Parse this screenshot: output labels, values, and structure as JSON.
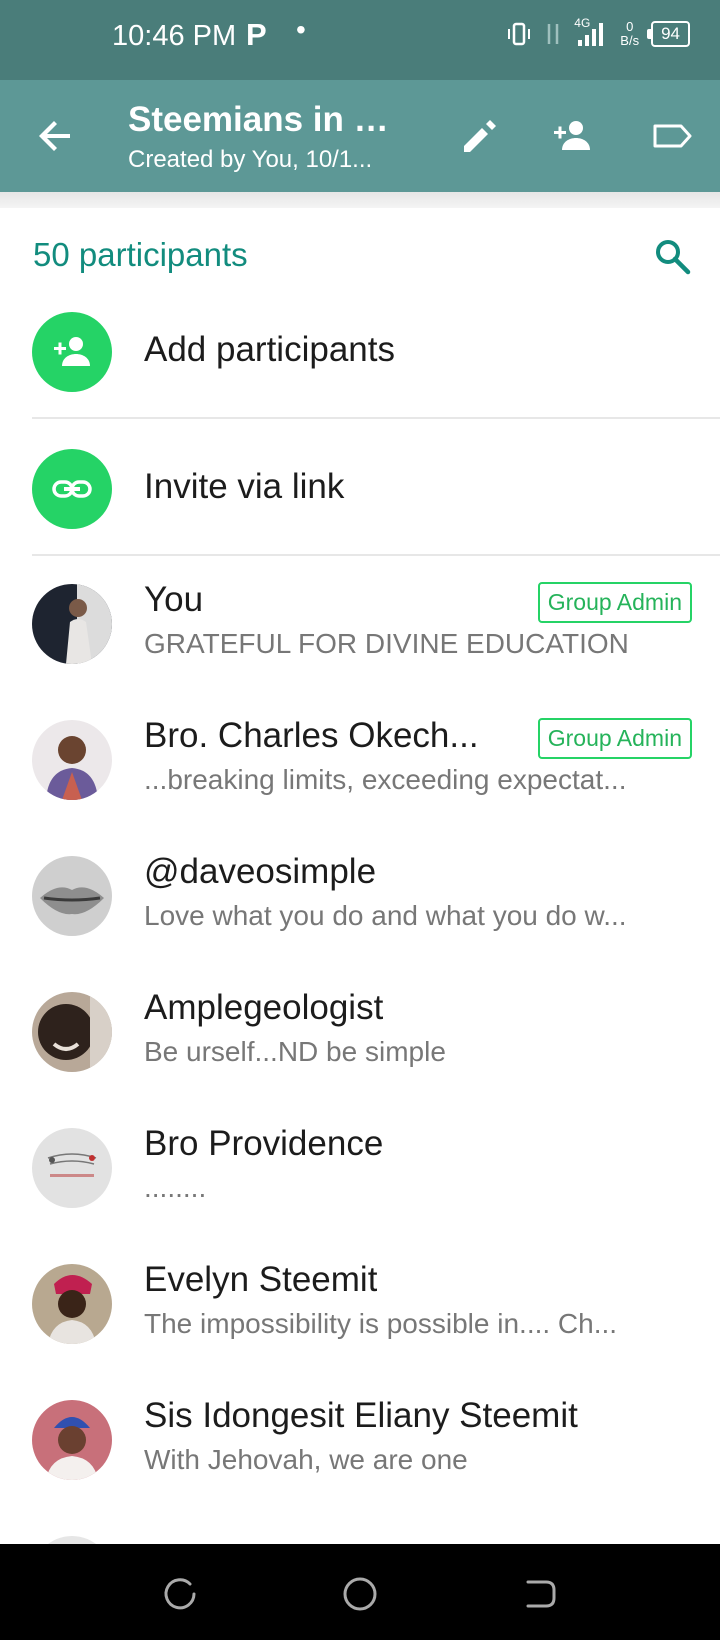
{
  "status_bar": {
    "time": "10:46 PM",
    "app_letter": "P",
    "dot": "•",
    "network": "4G",
    "data_rate_top": "0",
    "data_rate_bottom": "B/s",
    "battery": "94"
  },
  "app_bar": {
    "title": "Steemians in U...",
    "subtitle": "Created by You, 10/1..."
  },
  "participants_header": "50 participants",
  "actions": [
    {
      "label": "Add participants",
      "icon": "person-add-icon"
    },
    {
      "label": "Invite via link",
      "icon": "link-icon"
    }
  ],
  "participants": [
    {
      "name": "You",
      "about": "GRATEFUL FOR DIVINE EDUCATION",
      "badge": "Group Admin",
      "avatar_color": "#c9c2bd"
    },
    {
      "name": "Bro. Charles Okech...",
      "about": "...breaking limits, exceeding expectat...",
      "badge": "Group Admin",
      "avatar_color": "#a88a74"
    },
    {
      "name": "@daveosimple",
      "about": "Love what you do and what you do w...",
      "badge": "",
      "avatar_color": "#bdbdbd"
    },
    {
      "name": "Amplegeologist",
      "about": "Be urself...ND be simple",
      "badge": "",
      "avatar_color": "#5a4a40"
    },
    {
      "name": "Bro Providence",
      "about": "........",
      "badge": "",
      "avatar_color": "#dcdcdc"
    },
    {
      "name": "Evelyn Steemit",
      "about": "The impossibility is possible in.... Ch...",
      "badge": "",
      "avatar_color": "#8a6a50"
    },
    {
      "name": "Sis Idongesit Eliany Steemit",
      "about": "With Jehovah, we are one",
      "badge": "",
      "avatar_color": "#a8484a"
    }
  ],
  "colors": {
    "app_bar": "#5d9896",
    "status_bar": "#4a7d7a",
    "accent": "#128c7e",
    "green": "#25d366"
  }
}
